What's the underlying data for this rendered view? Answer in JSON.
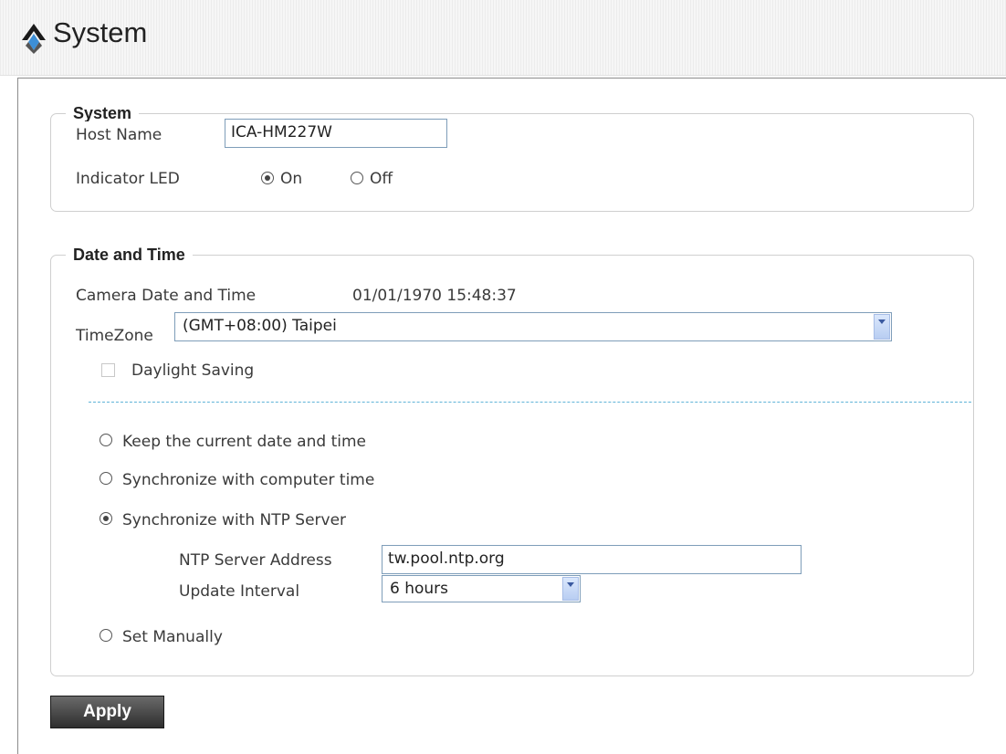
{
  "header": {
    "title": "System",
    "logo_icon": "caret-logo-icon"
  },
  "system_section": {
    "legend": "System",
    "host_name_label": "Host Name",
    "host_name_value": "ICA-HM227W",
    "indicator_led_label": "Indicator LED",
    "led_on_label": "On",
    "led_off_label": "Off",
    "led_selected": "On"
  },
  "datetime_section": {
    "legend": "Date and Time",
    "camera_datetime_label": "Camera Date and Time",
    "camera_datetime_value": "01/01/1970 15:48:37",
    "timezone_label": "TimeZone",
    "timezone_value": "(GMT+08:00) Taipei",
    "daylight_saving_label": "Daylight Saving",
    "daylight_saving_checked": false,
    "options": {
      "keep": "Keep the current date and time",
      "sync_computer": "Synchronize with computer time",
      "sync_ntp": "Synchronize with NTP Server",
      "manual": "Set Manually"
    },
    "selected_option": "Synchronize with NTP Server",
    "ntp_address_label": "NTP Server Address",
    "ntp_address_value": "tw.pool.ntp.org",
    "update_interval_label": "Update Interval",
    "update_interval_value": "6 hours"
  },
  "actions": {
    "apply_label": "Apply"
  },
  "colors": {
    "divider": "#5fb3d8",
    "select_border": "#7e9db9",
    "button_bg": "#3a3a3a"
  }
}
